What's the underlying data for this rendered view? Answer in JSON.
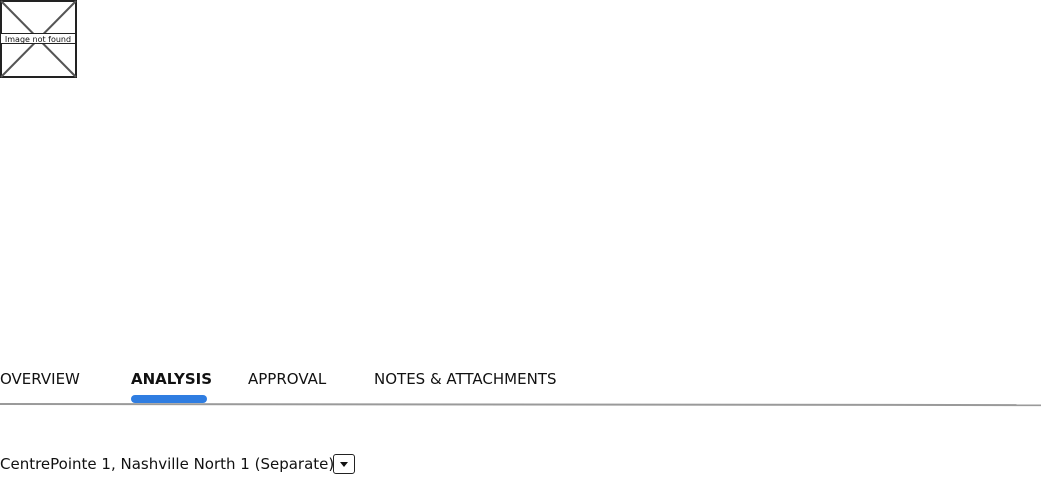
{
  "image_placeholder": {
    "label": "Image not found"
  },
  "tabs": [
    {
      "label": "OVERVIEW",
      "active": false
    },
    {
      "label": "ANALYSIS",
      "active": true
    },
    {
      "label": "APPROVAL",
      "active": false
    },
    {
      "label": "NOTES & ATTACHMENTS",
      "active": false
    }
  ],
  "selector": {
    "value": "CentrePointe 1, Nashville North 1 (Separate)",
    "icon": "chevron-down-icon"
  },
  "colors": {
    "accent": "#2f7de1",
    "divider": "#9a9a9a"
  }
}
